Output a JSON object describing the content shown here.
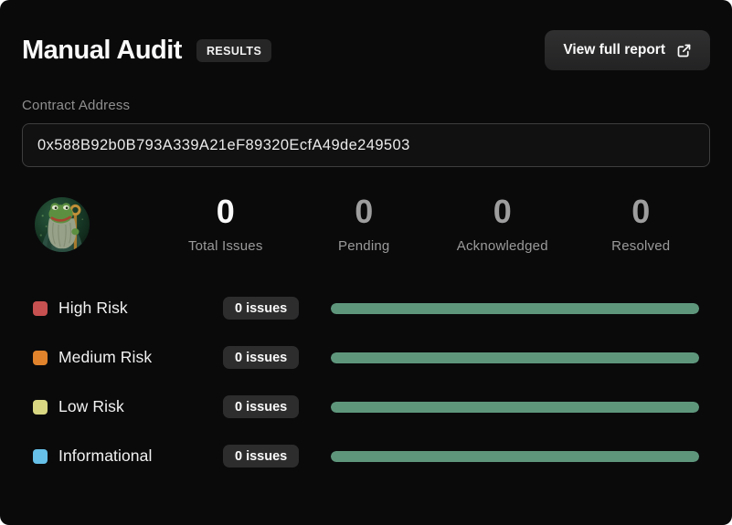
{
  "header": {
    "title": "Manual Audit",
    "badge": "RESULTS",
    "view_report_label": "View full report",
    "view_report_icon": "external-link-icon"
  },
  "contract": {
    "label": "Contract Address",
    "address": "0x588B92b0B793A339A21eF89320EcfA49de249503"
  },
  "avatar": {
    "icon": "frog-wizard-token-logo"
  },
  "stats": [
    {
      "value": "0",
      "label": "Total Issues"
    },
    {
      "value": "0",
      "label": "Pending"
    },
    {
      "value": "0",
      "label": "Acknowledged"
    },
    {
      "value": "0",
      "label": "Resolved"
    }
  ],
  "risks": [
    {
      "label": "High Risk",
      "count_label": "0 issues",
      "color": "#c75050",
      "progress": 100
    },
    {
      "label": "Medium Risk",
      "count_label": "0 issues",
      "color": "#e0832c",
      "progress": 100
    },
    {
      "label": "Low Risk",
      "count_label": "0 issues",
      "color": "#d9d782",
      "progress": 100
    },
    {
      "label": "Informational",
      "count_label": "0 issues",
      "color": "#66c0e8",
      "progress": 100
    }
  ],
  "colors": {
    "progress_bar": "#5e967c",
    "card_background": "#0a0a0b",
    "badge_background": "#2d2d2e"
  }
}
